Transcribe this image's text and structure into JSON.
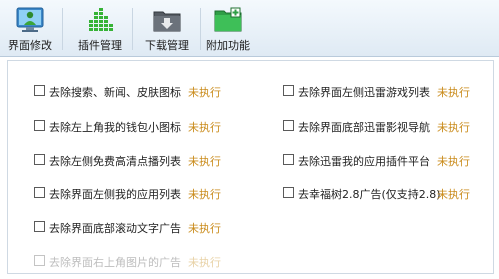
{
  "toolbar": {
    "items": [
      {
        "label": "界面修改"
      },
      {
        "label": "插件管理"
      },
      {
        "label": "下载管理"
      },
      {
        "label": "附加功能"
      }
    ]
  },
  "options": {
    "left": [
      {
        "label": "去除搜索、新闻、皮肤图标",
        "status": "未执行"
      },
      {
        "label": "去除左上角我的钱包小图标",
        "status": "未执行"
      },
      {
        "label": "去除左侧免费高清点播列表",
        "status": "未执行"
      },
      {
        "label": "去除界面左侧我的应用列表",
        "status": "未执行"
      },
      {
        "label": "去除界面底部滚动文字广告",
        "status": "未执行"
      },
      {
        "label": "去除界面右上角图片的广告",
        "status": "未执行"
      }
    ],
    "right": [
      {
        "label": "去除界面左侧迅雷游戏列表",
        "status": "未执行"
      },
      {
        "label": "去除界面底部迅雷影视导航",
        "status": "未执行"
      },
      {
        "label": "去除迅雷我的应用插件平台",
        "status": "未执行"
      },
      {
        "label": "去幸福树2.8广告(仅支持2.8)",
        "status": "未执行"
      }
    ]
  },
  "colors": {
    "status": "#c98a19",
    "toolbar_top": "#f4f9fd",
    "toolbar_bottom": "#dfeaf4"
  }
}
